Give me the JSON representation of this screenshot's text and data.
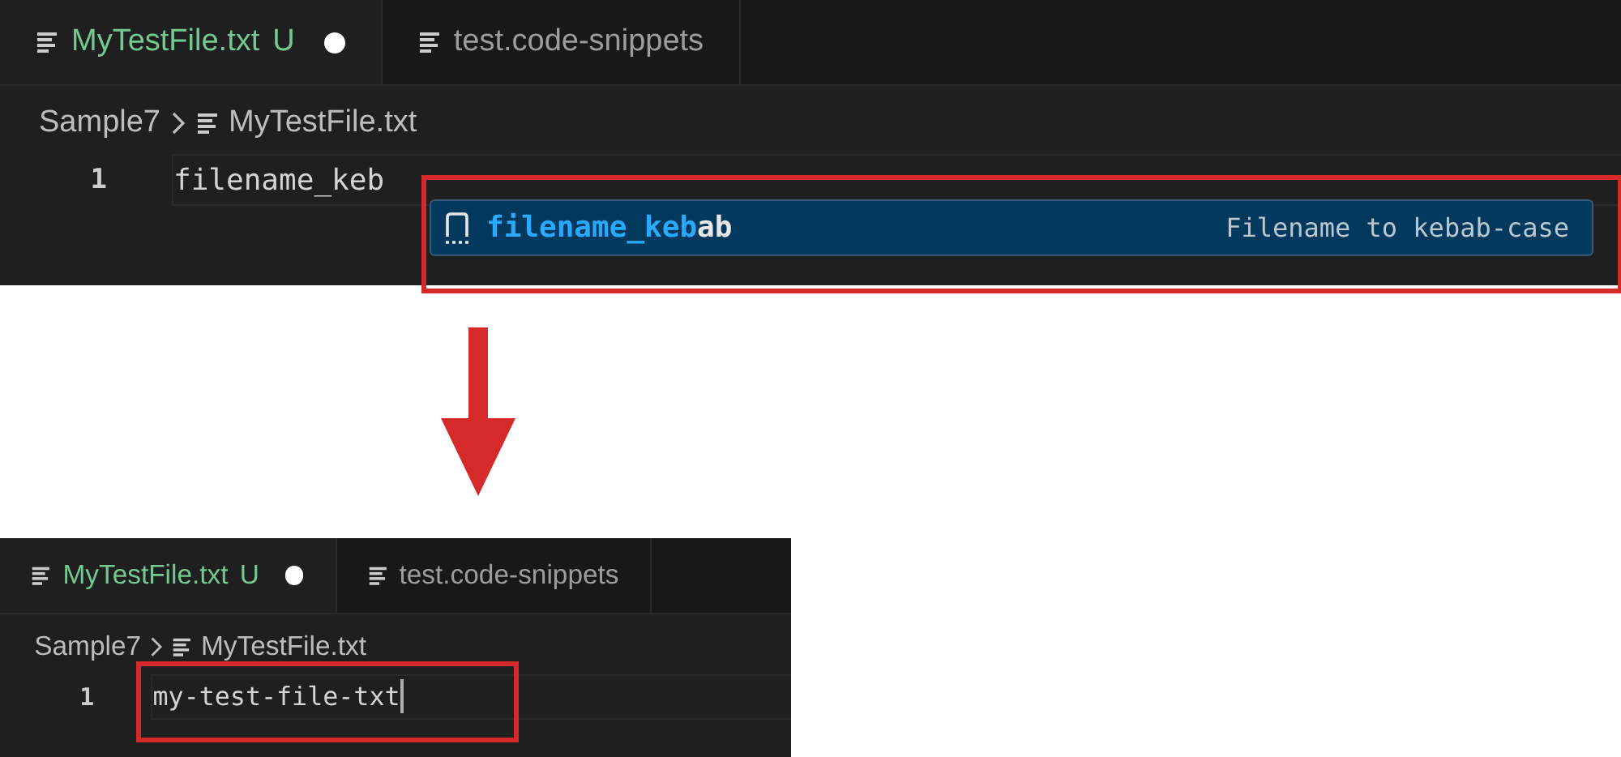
{
  "panels": [
    {
      "tabs": [
        {
          "label": "MyTestFile.txt",
          "badge": "U",
          "modified": true,
          "selected": true
        },
        {
          "label": "test.code-snippets",
          "modified": false,
          "selected": false
        }
      ],
      "breadcrumb": [
        "Sample7",
        "MyTestFile.txt"
      ],
      "lines": [
        {
          "number": "1",
          "text": "filename_keb"
        }
      ],
      "suggestion": {
        "match": "filename_keb",
        "rest": "ab",
        "detail": "Filename to kebab-case",
        "highlighted": true
      }
    },
    {
      "tabs": [
        {
          "label": "MyTestFile.txt",
          "badge": "U",
          "modified": true,
          "selected": true
        },
        {
          "label": "test.code-snippets",
          "modified": false,
          "selected": false
        }
      ],
      "breadcrumb": [
        "Sample7",
        "MyTestFile.txt"
      ],
      "lines": [
        {
          "number": "1",
          "text": "my-test-file-txt",
          "highlighted": true
        }
      ],
      "cursor": true
    }
  ]
}
